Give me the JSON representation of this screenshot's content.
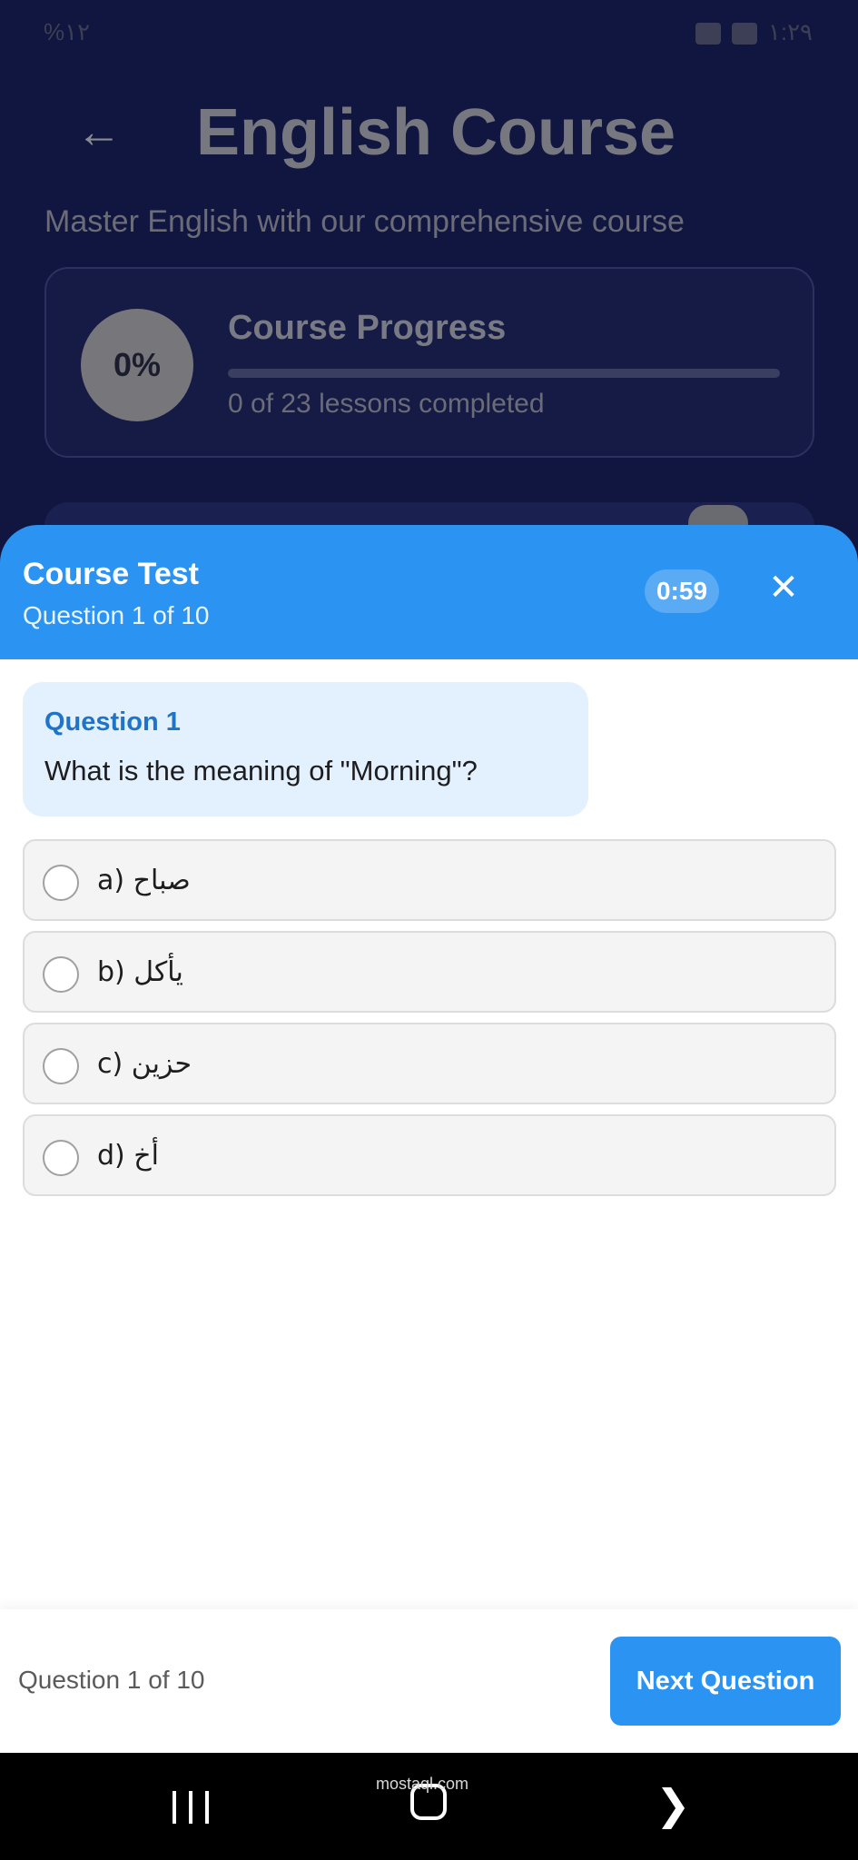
{
  "status_bar": {
    "left": "%١٢",
    "right": "١:٢٩"
  },
  "course": {
    "title": "English Course",
    "subtitle": "Master English with our comprehensive course",
    "progress_percent": "0%",
    "progress_title": "Course Progress",
    "progress_fraction": 0,
    "progress_text": "0 of 23 lessons completed"
  },
  "test": {
    "title": "Course Test",
    "subtitle": "Question 1 of 10",
    "timer": "0:59"
  },
  "question": {
    "label": "Question 1",
    "text": "What is the meaning of \"Morning\"?"
  },
  "options": [
    {
      "letter": "a)",
      "text": "صباح"
    },
    {
      "letter": "b)",
      "text": "يأكل"
    },
    {
      "letter": "c)",
      "text": "حزين"
    },
    {
      "letter": "d)",
      "text": "أخ"
    }
  ],
  "footer": {
    "status": "Question 1 of 10",
    "next_label": "Next Question"
  },
  "watermark": "mostaql.com",
  "colors": {
    "primary": "#2b94f3",
    "background_dim": "#10163f",
    "question_bg": "#e3f0fd"
  }
}
